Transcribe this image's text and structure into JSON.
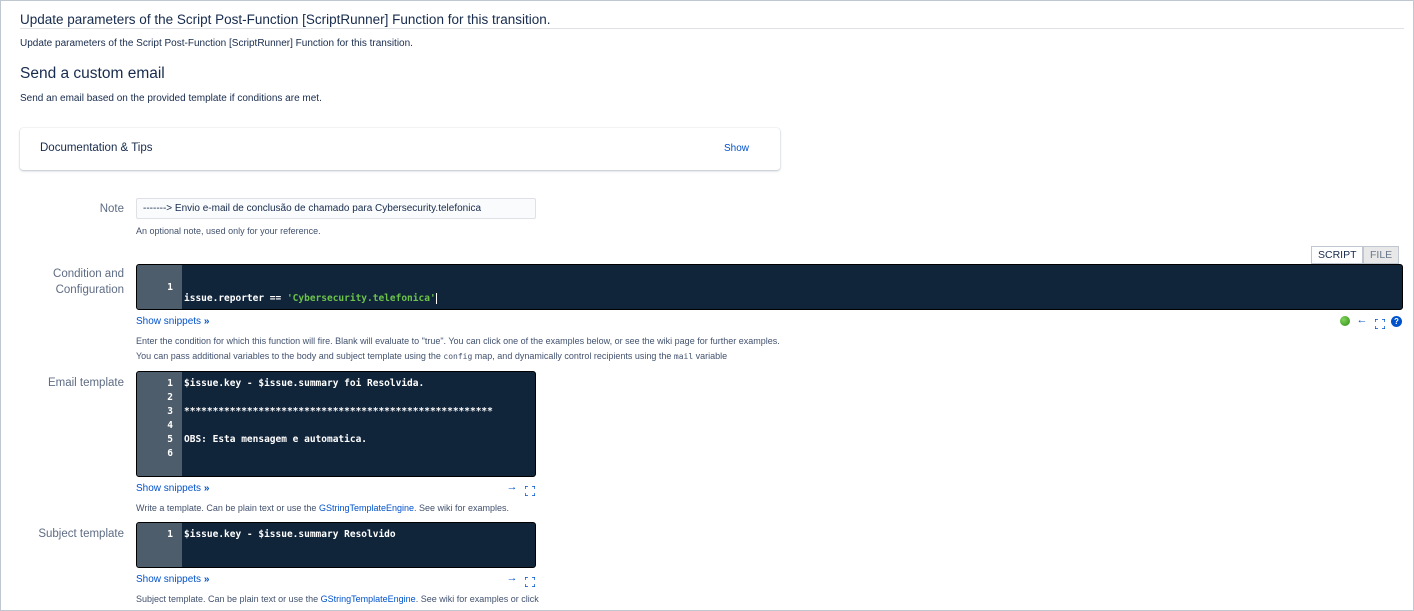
{
  "page": {
    "title": "Update parameters of the Script Post-Function [ScriptRunner] Function for this transition.",
    "subtitle": "Update parameters of the Script Post-Function [ScriptRunner] Function for this transition."
  },
  "section": {
    "heading": "Send a custom email",
    "description": "Send an email based on the provided template if conditions are met."
  },
  "docs": {
    "title": "Documentation & Tips",
    "show_label": "Show"
  },
  "note": {
    "label": "Note",
    "value": "-------> Envio e-mail de conclusão de chamado para Cybersecurity.telefonica",
    "help": "An optional note, used only for your reference."
  },
  "condition": {
    "label_line1": "Condition and",
    "label_line2": "Configuration",
    "mode_buttons": {
      "script": "SCRIPT",
      "file": "FILE"
    },
    "lines": [
      {
        "num": "1",
        "code_prefix": "issue.reporter == ",
        "code_string": "'Cybersecurity.telefonica'"
      }
    ],
    "snippets_label": "Show snippets",
    "help_line1": "Enter the condition for which this function will fire. Blank will evaluate to \"true\". You can click one of the examples below, or see the wiki page for further examples.",
    "help_line2_a": "You can pass additional variables to the body and subject template using the ",
    "help_line2_code1": "config",
    "help_line2_b": " map, and dynamically control recipients using the ",
    "help_line2_code2": "mail",
    "help_line2_c": " variable",
    "icons": [
      "status-ok-icon",
      "arrow-left-icon",
      "expand-icon",
      "help-icon"
    ]
  },
  "email_template": {
    "label": "Email template",
    "lines": [
      {
        "num": "1",
        "code": "$issue.key - $issue.summary foi Resolvida."
      },
      {
        "num": "2",
        "code": ""
      },
      {
        "num": "3",
        "code": "******************************************************"
      },
      {
        "num": "4",
        "code": ""
      },
      {
        "num": "5",
        "code": "OBS: Esta mensagem e automatica."
      },
      {
        "num": "6",
        "code": ""
      }
    ],
    "snippets_label": "Show snippets",
    "help_a": "Write a template. Can be plain text or use the ",
    "help_link": "GStringTemplateEngine",
    "help_b": ". See wiki for examples."
  },
  "subject_template": {
    "label": "Subject template",
    "lines": [
      {
        "num": "1",
        "code": "$issue.key - $issue.summary Resolvido"
      }
    ],
    "snippets_label": "Show snippets",
    "help_a": "Subject template. Can be plain text or use the ",
    "help_link": "GStringTemplateEngine",
    "help_b": ". See wiki for examples or click"
  },
  "colors": {
    "editor_bg": "#10243a",
    "gutter_bg": "#4e5d6c",
    "string": "#6cc24a",
    "link": "#0052cc"
  }
}
